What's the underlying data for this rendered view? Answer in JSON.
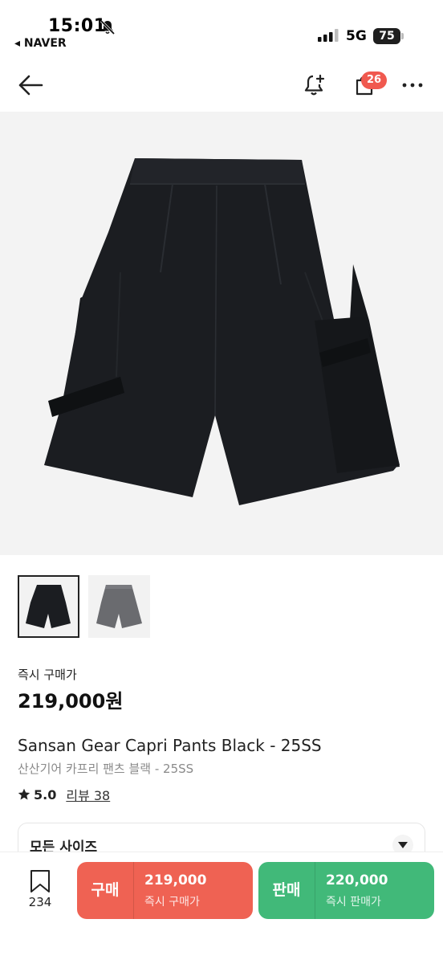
{
  "status_bar": {
    "time": "15:01",
    "back_app": "◂ NAVER",
    "network": "5G",
    "battery": "75"
  },
  "header": {
    "cart_badge": "26"
  },
  "product": {
    "buy_now_label": "즉시 구매가",
    "price": "219,000원",
    "name_en": "Sansan Gear Capri Pants Black - 25SS",
    "name_ko": "산산기어 카프리 팬츠 블랙 - 25SS",
    "rating": "5.0",
    "review_link": "리뷰 38",
    "size_select_label": "모든 사이즈",
    "thumbnails": [
      {
        "color": "Black",
        "selected": true
      },
      {
        "color": "Gray",
        "selected": false
      }
    ]
  },
  "bottom_bar": {
    "wish_count": "234",
    "buy": {
      "kind": "구매",
      "amount": "219,000",
      "sub": "즉시 구매가",
      "color": "#ef6253"
    },
    "sell": {
      "kind": "판매",
      "amount": "220,000",
      "sub": "즉시 판매가",
      "color": "#41b979"
    }
  },
  "icons": [
    "bell-muted-icon",
    "signal-icon",
    "battery-icon",
    "back-arrow-icon",
    "notification-bell-icon",
    "cart-bag-icon",
    "more-dots-icon",
    "star-icon",
    "chevron-down-icon",
    "bookmark-icon"
  ]
}
